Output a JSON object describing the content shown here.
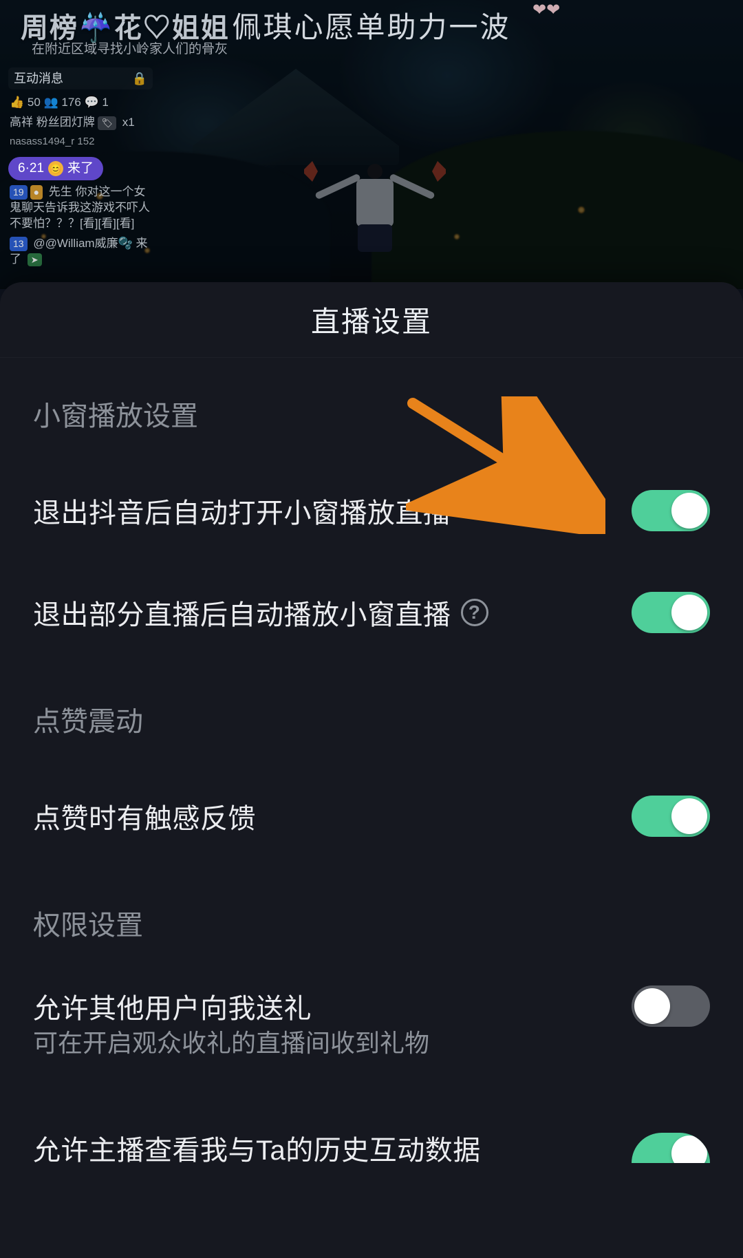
{
  "background": {
    "rankTitle": "周榜☔花♡姐姐",
    "rankSub": "在附近区域寻找小岭家人们的骨灰",
    "wishTitle": "佩琪心愿单助力一波",
    "chat": {
      "header": "互动消息",
      "stats": "👍 50  👥 176  💬 1",
      "line1a": "高祥",
      "line1b": "粉丝团灯牌",
      "line1c": "x1",
      "lineMeta": "nasass1494_r 152",
      "pillPrefix": "6·21",
      "pillText": "来了",
      "msgName": "先生",
      "msgBody": "你对这一个女鬼聊天告诉我这游戏不吓人不要怕？？？[看][看][看]",
      "joinText": "@@William威廉🫧 来了"
    }
  },
  "sheet": {
    "title": "直播设置",
    "sections": {
      "pip": {
        "label": "小窗播放设置",
        "item1": {
          "label": "退出抖音后自动打开小窗播放直播",
          "on": true
        },
        "item2": {
          "label": "退出部分直播后自动播放小窗直播",
          "on": true
        }
      },
      "like": {
        "label": "点赞震动",
        "item1": {
          "label": "点赞时有触感反馈",
          "on": true
        }
      },
      "perm": {
        "label": "权限设置",
        "item1": {
          "label": "允许其他用户向我送礼",
          "desc": "可在开启观众收礼的直播间收到礼物",
          "on": false
        },
        "item2": {
          "label": "允许主播查看我与Ta的历史互动数据",
          "on": true
        }
      }
    }
  },
  "colors": {
    "toggleOn": "#4fcf9a",
    "toggleOff": "#5a5d64",
    "arrow": "#e8831b"
  }
}
